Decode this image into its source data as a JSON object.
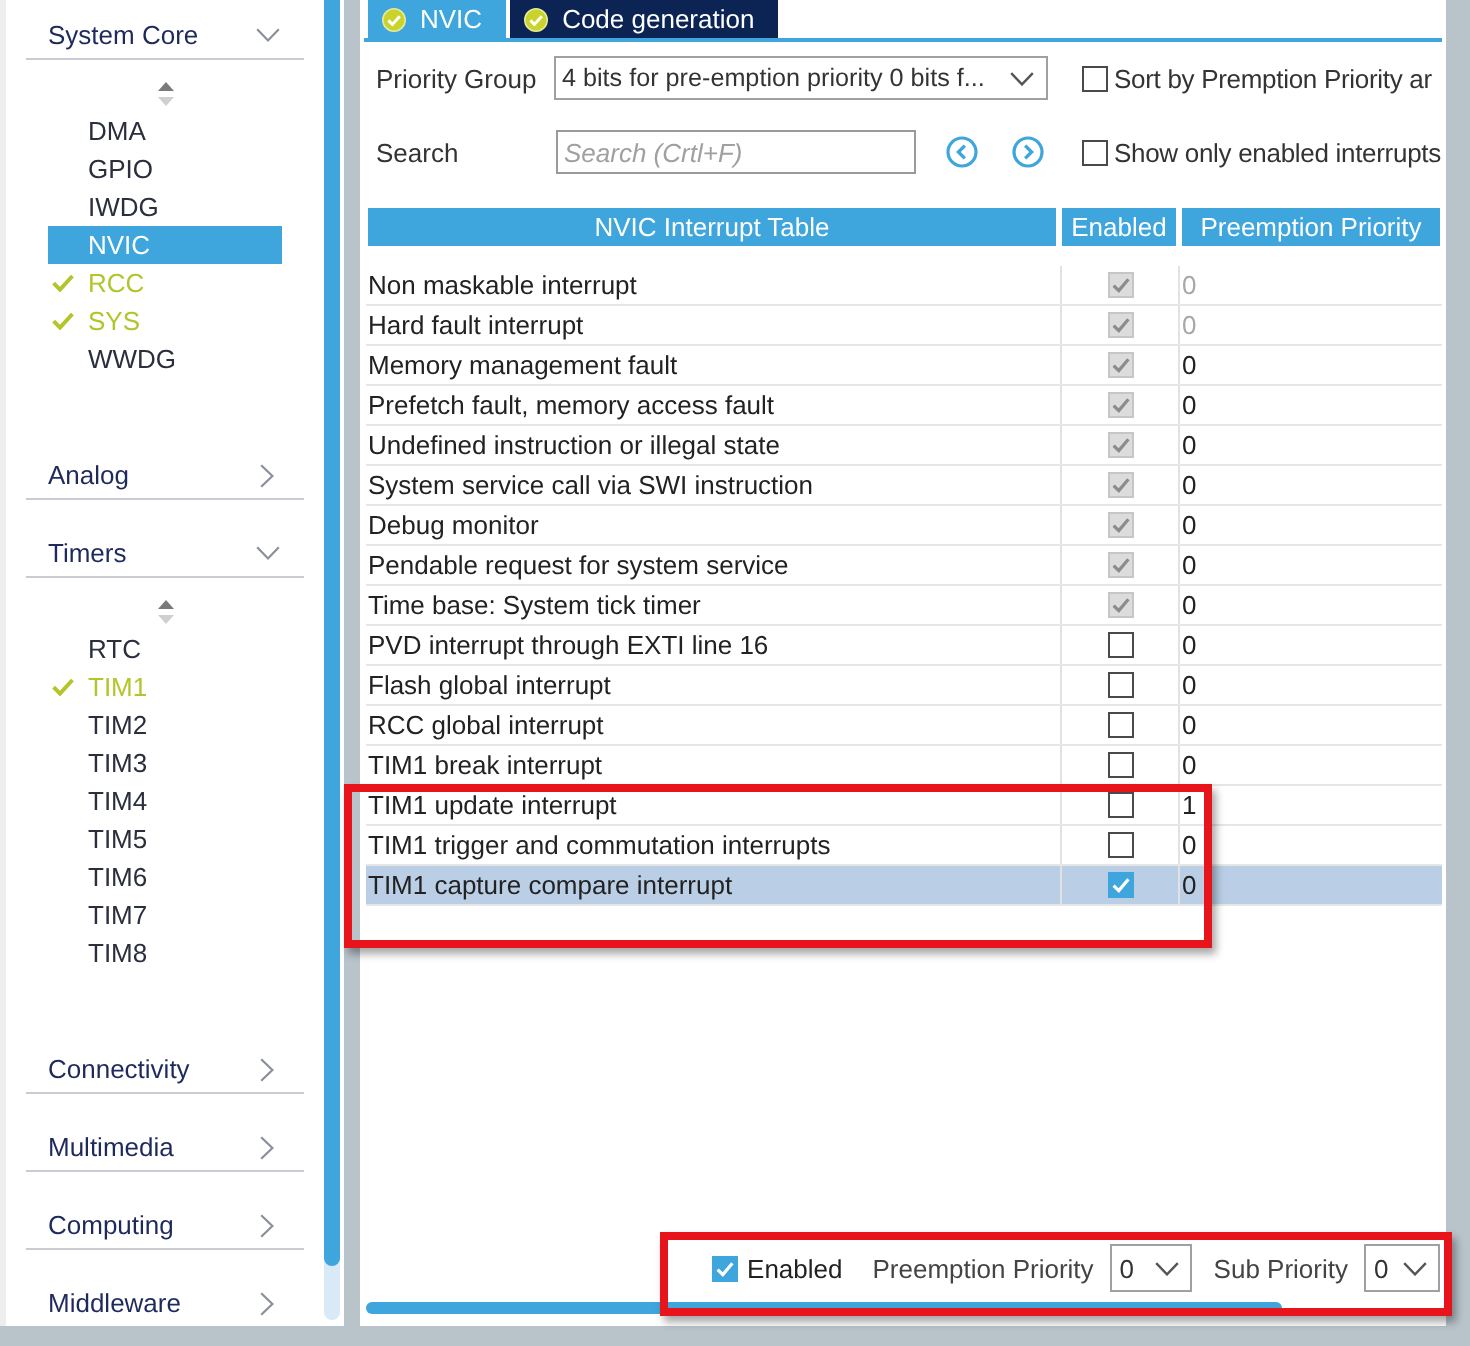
{
  "sidebar": {
    "categories": [
      {
        "label": "System Core",
        "expanded": true,
        "items": [
          {
            "label": "DMA",
            "selected": false,
            "configured": false
          },
          {
            "label": "GPIO",
            "selected": false,
            "configured": false
          },
          {
            "label": "IWDG",
            "selected": false,
            "configured": false
          },
          {
            "label": "NVIC",
            "selected": true,
            "configured": false
          },
          {
            "label": "RCC",
            "selected": false,
            "configured": true
          },
          {
            "label": "SYS",
            "selected": false,
            "configured": true
          },
          {
            "label": "WWDG",
            "selected": false,
            "configured": false
          }
        ]
      },
      {
        "label": "Analog",
        "expanded": false
      },
      {
        "label": "Timers",
        "expanded": true,
        "items": [
          {
            "label": "RTC",
            "selected": false,
            "configured": false
          },
          {
            "label": "TIM1",
            "selected": false,
            "configured": true
          },
          {
            "label": "TIM2",
            "selected": false,
            "configured": false
          },
          {
            "label": "TIM3",
            "selected": false,
            "configured": false
          },
          {
            "label": "TIM4",
            "selected": false,
            "configured": false
          },
          {
            "label": "TIM5",
            "selected": false,
            "configured": false
          },
          {
            "label": "TIM6",
            "selected": false,
            "configured": false
          },
          {
            "label": "TIM7",
            "selected": false,
            "configured": false
          },
          {
            "label": "TIM8",
            "selected": false,
            "configured": false
          }
        ]
      },
      {
        "label": "Connectivity",
        "expanded": false
      },
      {
        "label": "Multimedia",
        "expanded": false
      },
      {
        "label": "Computing",
        "expanded": false
      },
      {
        "label": "Middleware",
        "expanded": false
      }
    ]
  },
  "tabs": [
    {
      "label": "NVIC",
      "selected": true,
      "done": true
    },
    {
      "label": "Code generation",
      "selected": false,
      "done": true
    }
  ],
  "priority_group": {
    "label": "Priority Group",
    "value": "4 bits for pre-emption priority 0 bits f..."
  },
  "sort_option": {
    "label": "Sort by Premption Priority ar",
    "checked": false
  },
  "search": {
    "label": "Search",
    "placeholder": "Search (Crtl+F)"
  },
  "enabled_only_option": {
    "label": "Show only enabled interrupts",
    "checked": false
  },
  "table": {
    "columns": [
      "NVIC Interrupt Table",
      "Enabled",
      "Preemption Priority"
    ],
    "rows": [
      {
        "name": "Non maskable interrupt",
        "enabled": true,
        "enabled_locked": true,
        "priority": "0",
        "priority_locked": true,
        "selected": false
      },
      {
        "name": "Hard fault interrupt",
        "enabled": true,
        "enabled_locked": true,
        "priority": "0",
        "priority_locked": true,
        "selected": false
      },
      {
        "name": "Memory management fault",
        "enabled": true,
        "enabled_locked": true,
        "priority": "0",
        "priority_locked": false,
        "selected": false
      },
      {
        "name": "Prefetch fault, memory access fault",
        "enabled": true,
        "enabled_locked": true,
        "priority": "0",
        "priority_locked": false,
        "selected": false
      },
      {
        "name": "Undefined instruction or illegal state",
        "enabled": true,
        "enabled_locked": true,
        "priority": "0",
        "priority_locked": false,
        "selected": false
      },
      {
        "name": "System service call via SWI instruction",
        "enabled": true,
        "enabled_locked": true,
        "priority": "0",
        "priority_locked": false,
        "selected": false
      },
      {
        "name": "Debug monitor",
        "enabled": true,
        "enabled_locked": true,
        "priority": "0",
        "priority_locked": false,
        "selected": false
      },
      {
        "name": "Pendable request for system service",
        "enabled": true,
        "enabled_locked": true,
        "priority": "0",
        "priority_locked": false,
        "selected": false
      },
      {
        "name": "Time base: System tick timer",
        "enabled": true,
        "enabled_locked": true,
        "priority": "0",
        "priority_locked": false,
        "selected": false
      },
      {
        "name": "PVD interrupt through EXTI line 16",
        "enabled": false,
        "enabled_locked": false,
        "priority": "0",
        "priority_locked": false,
        "selected": false
      },
      {
        "name": "Flash global interrupt",
        "enabled": false,
        "enabled_locked": false,
        "priority": "0",
        "priority_locked": false,
        "selected": false
      },
      {
        "name": "RCC global interrupt",
        "enabled": false,
        "enabled_locked": false,
        "priority": "0",
        "priority_locked": false,
        "selected": false
      },
      {
        "name": "TIM1 break interrupt",
        "enabled": false,
        "enabled_locked": false,
        "priority": "0",
        "priority_locked": false,
        "selected": false
      },
      {
        "name": "TIM1 update interrupt",
        "enabled": false,
        "enabled_locked": false,
        "priority": "1",
        "priority_locked": false,
        "selected": false
      },
      {
        "name": "TIM1 trigger and commutation interrupts",
        "enabled": false,
        "enabled_locked": false,
        "priority": "0",
        "priority_locked": false,
        "selected": false
      },
      {
        "name": "TIM1 capture compare interrupt",
        "enabled": true,
        "enabled_locked": false,
        "priority": "0",
        "priority_locked": false,
        "selected": true
      }
    ]
  },
  "details": {
    "enabled": {
      "label": "Enabled",
      "checked": true
    },
    "preemption_priority": {
      "label": "Preemption Priority",
      "value": "0"
    },
    "sub_priority": {
      "label": "Sub Priority",
      "value": "0"
    }
  }
}
